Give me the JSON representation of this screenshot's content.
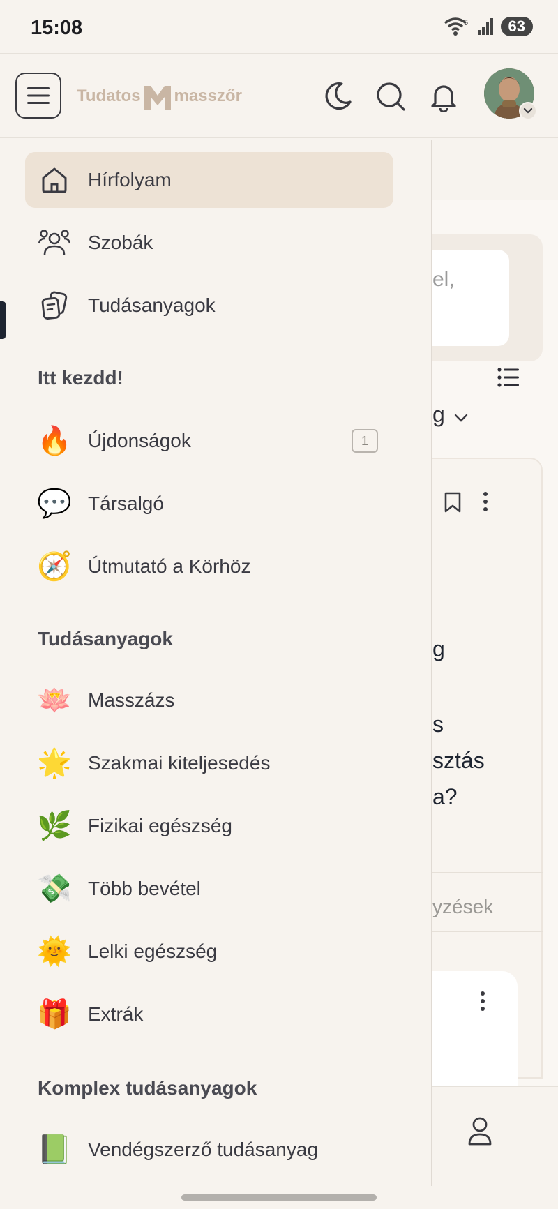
{
  "status_bar": {
    "time": "15:08",
    "battery": "63",
    "wifi_badge": "5"
  },
  "header": {
    "logo_left": "Tudatos",
    "logo_right": "masszőr",
    "icons": [
      "menu-icon",
      "moon-icon",
      "search-icon",
      "bell-icon",
      "avatar",
      "chevron-down-icon"
    ]
  },
  "drawer": {
    "main": [
      {
        "label": "Hírfolyam",
        "icon": "home-icon",
        "active": true
      },
      {
        "label": "Szobák",
        "icon": "people-icon"
      },
      {
        "label": "Tudásanyagok",
        "icon": "documents-icon"
      }
    ],
    "sections": [
      {
        "title": "Itt kezdd!",
        "items": [
          {
            "label": "Újdonságok",
            "emoji": "🔥",
            "badge": "1"
          },
          {
            "label": "Társalgó",
            "emoji": "💬"
          },
          {
            "label": "Útmutató a Körhöz",
            "emoji": "🧭"
          }
        ]
      },
      {
        "title": "Tudásanyagok",
        "items": [
          {
            "label": "Masszázs",
            "emoji": "🪷"
          },
          {
            "label": "Szakmai kiteljesedés",
            "emoji": "🌟"
          },
          {
            "label": "Fizikai egészség",
            "emoji": "🌿"
          },
          {
            "label": "Több bevétel",
            "emoji": "💸"
          },
          {
            "label": "Lelki egészség",
            "emoji": "🌞"
          },
          {
            "label": "Extrák",
            "emoji": "🎁"
          }
        ]
      },
      {
        "title": "Komplex tudásanyagok",
        "items": [
          {
            "label": "Vendégszerző tudásanyag",
            "emoji": "📗"
          }
        ]
      }
    ]
  },
  "background": {
    "search_fragment_1": "el,",
    "filter_fragment": "g",
    "post_lines": [
      "g",
      "s",
      "sztás",
      "a?"
    ],
    "comments_fragment": "yzések"
  },
  "colors": {
    "accent_active": "#ede2d5",
    "background": "#f7f3ee",
    "logo": "#c9b6a4"
  }
}
